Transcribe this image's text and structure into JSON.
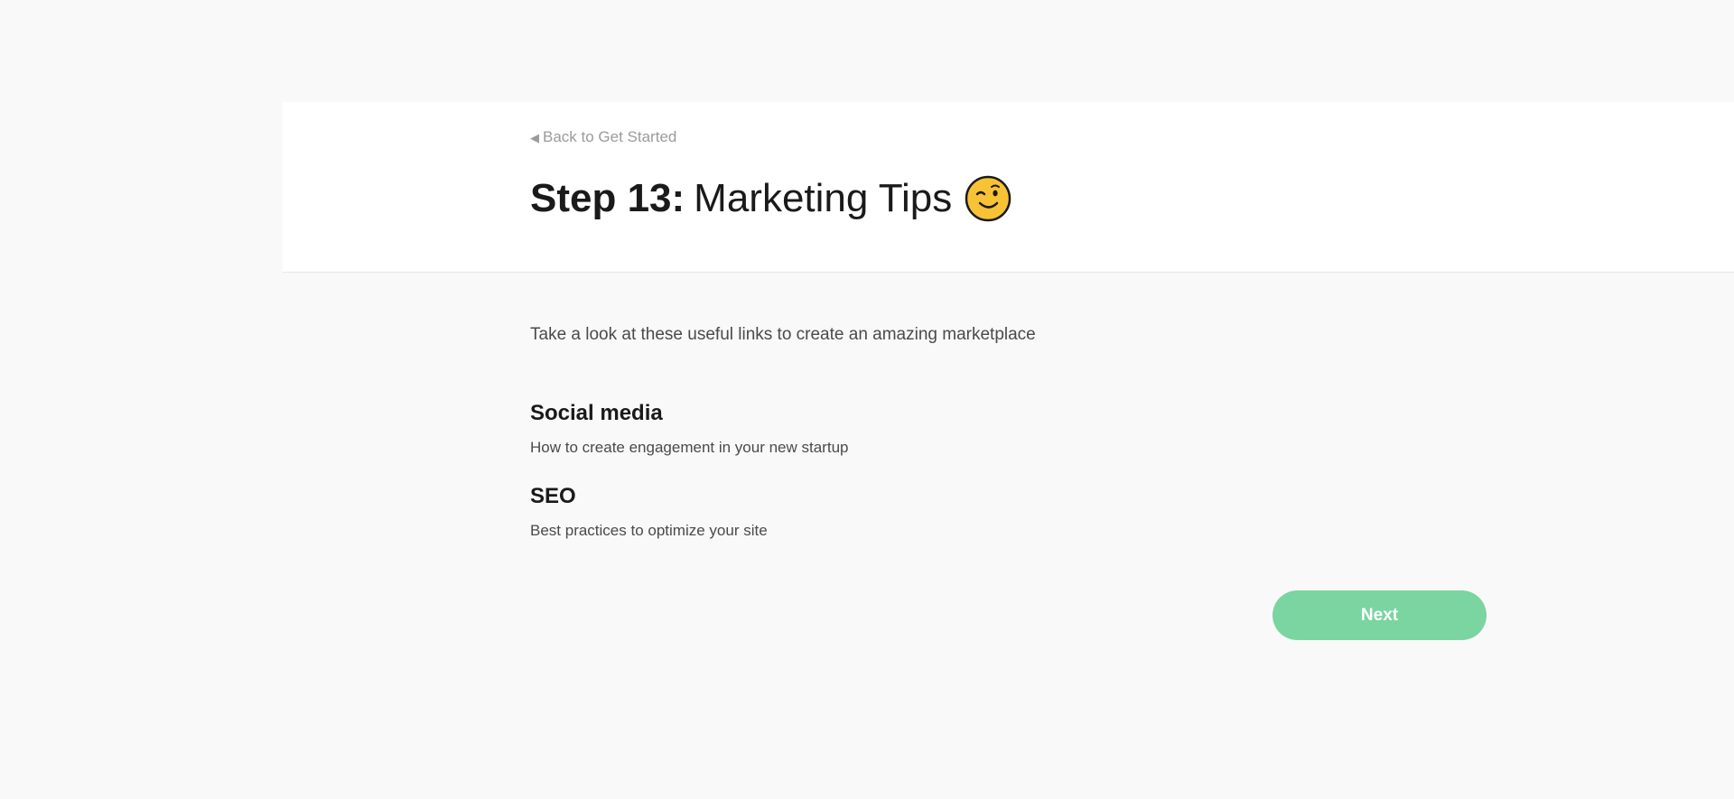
{
  "header": {
    "back_link": "Back to Get Started",
    "title_step": "Step 13:",
    "title_text": "Marketing Tips",
    "title_icon": "winking-face-icon"
  },
  "main": {
    "intro": "Take a look at these useful links to create an amazing marketplace",
    "tips": [
      {
        "title": "Social media",
        "description": "How to create engagement in your new startup"
      },
      {
        "title": "SEO",
        "description": "Best practices to optimize your site"
      }
    ]
  },
  "footer": {
    "next_label": "Next"
  },
  "colors": {
    "background": "#f9f9f9",
    "panel": "#ffffff",
    "accent": "#7ad5a1",
    "muted_text": "#9b9b9b",
    "body_text": "#4a4a4a",
    "heading_text": "#1a1a1a"
  }
}
